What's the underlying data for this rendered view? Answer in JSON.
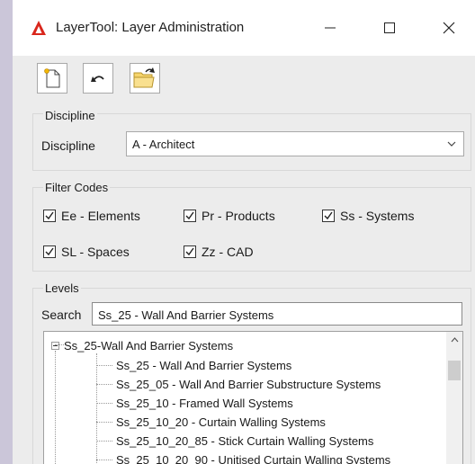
{
  "window": {
    "title": "LayerTool: Layer Administration"
  },
  "toolbar": {
    "buttons": [
      {
        "icon": "new-layer-icon"
      },
      {
        "icon": "undo-icon"
      },
      {
        "icon": "open-folder-icon"
      }
    ]
  },
  "discipline": {
    "group_label": "Discipline",
    "field_label": "Discipline",
    "selected": "A - Architect"
  },
  "filter_codes": {
    "group_label": "Filter Codes",
    "items": [
      {
        "label": "Ee - Elements",
        "checked": true
      },
      {
        "label": "Pr - Products",
        "checked": true
      },
      {
        "label": "Ss - Systems",
        "checked": true
      },
      {
        "label": "SL - Spaces",
        "checked": true
      },
      {
        "label": "Zz - CAD",
        "checked": true
      }
    ]
  },
  "levels": {
    "group_label": "Levels",
    "search_label": "Search",
    "search_value": "Ss_25 - Wall And Barrier Systems",
    "tree": {
      "root": "Ss_25-Wall And Barrier Systems",
      "children": [
        "Ss_25 - Wall And Barrier Systems",
        "Ss_25_05 - Wall And Barrier Substructure Systems",
        "Ss_25_10 - Framed Wall Systems",
        "Ss_25_10_20 - Curtain Walling Systems",
        "Ss_25_10_20_85 - Stick Curtain Walling Systems",
        "Ss_25_10_20_90 - Unitised Curtain Walling Systems"
      ]
    }
  },
  "colors": {
    "accent_red": "#d9261c",
    "folder_yellow": "#f6d46b"
  }
}
